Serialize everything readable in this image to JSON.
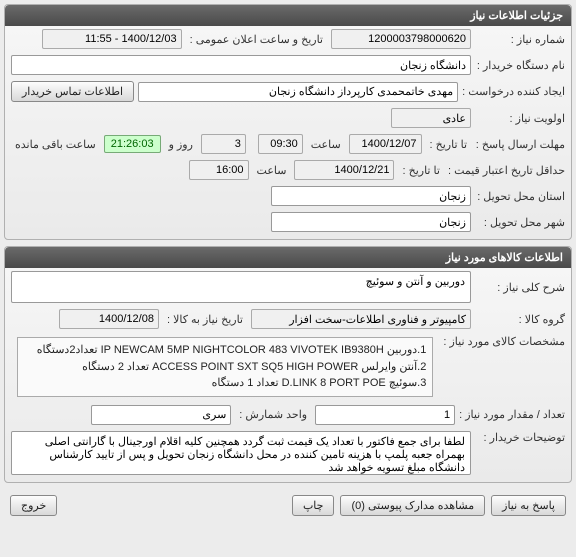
{
  "panel1": {
    "title": "جزئیات اطلاعات نیاز",
    "need_no_label": "شماره نیاز :",
    "need_no": "1200003798000620",
    "announce_label": "تاریخ و ساعت اعلان عمومی :",
    "announce_value": "1400/12/03 - 11:55",
    "buyer_label": "نام دستگاه خریدار :",
    "buyer_value": "دانشگاه زنجان",
    "creator_label": "ایجاد کننده درخواست :",
    "creator_value": "مهدی خاتمحمدی کارپرداز دانشگاه زنجان",
    "contact_btn": "اطلاعات تماس خریدار",
    "priority_label": "اولویت نیاز :",
    "priority_value": "عادی",
    "deadline_send_label": "مهلت ارسال پاسخ :",
    "to_date_label": "تا تاریخ :",
    "deadline_date": "1400/12/07",
    "time_label": "ساعت",
    "deadline_time": "09:30",
    "days_value": "3",
    "days_label": "روز و",
    "timer": "21:26:03",
    "remaining_label": "ساعت باقی مانده",
    "price_validity_label": "حداقل تاریخ اعتبار قیمت :",
    "price_validity_date": "1400/12/21",
    "price_validity_time": "16:00",
    "province_label": "استان محل تحویل :",
    "province_value": "زنجان",
    "city_label": "شهر محل تحویل :",
    "city_value": "زنجان"
  },
  "panel2": {
    "title": "اطلاعات کالاهای مورد نیاز",
    "general_desc_label": "شرح کلی نیاز :",
    "general_desc_value": "دوربین و آنتن و سوئیچ",
    "group_label": "گروه کالا :",
    "group_value": "کامپیوتر و فناوری اطلاعات-سخت افزار",
    "need_date_label": "تاریخ نیاز به کالا :",
    "need_date_value": "1400/12/08",
    "specs_label": "مشخصات کالای مورد نیاز :",
    "specs_line1": "1.دوربین IP NEWCAM 5MP NIGHTCOLOR 483 VIVOTEK IB9380H تعداد2دستگاه",
    "specs_line2": "2.آنتن وایرلس ACCESS POINT SXT SQ5 HIGH POWER تعداد 2 دستگاه",
    "specs_line3": "3.سوئیچ D.LINK 8 PORT POE تعداد 1 دستگاه",
    "qty_label": "تعداد / مقدار مورد نیاز :",
    "qty_value": "1",
    "unit_label": "واحد شمارش :",
    "unit_value": "سری",
    "buyer_notes_label": "توضیحات خریدار :",
    "buyer_notes_value": "لطفا برای جمع فاکتور با تعداد یک قیمت ثبت گردد همچنین کلیه اقلام اورجینال با گارانتی اصلی بهمراه جعبه پلمپ با هزینه تامین کننده در محل دانشگاه زنجان تحویل و پس از تایید کارشناس دانشگاه مبلغ تسویه خواهد شد"
  },
  "footer": {
    "reply": "پاسخ به نیاز",
    "attachments": "مشاهده مدارک پیوستی (0)",
    "print": "چاپ",
    "exit": "خروج"
  }
}
